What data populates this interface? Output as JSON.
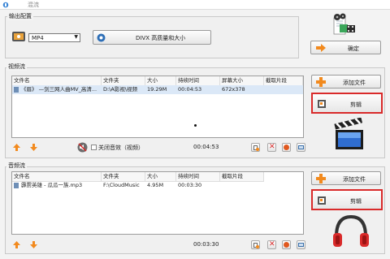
{
  "window": {
    "title": "混流"
  },
  "output": {
    "group_label": "输出配置",
    "format_value": "MP4",
    "quality_value": "DIVX 高质量和大小",
    "confirm_label": "确定"
  },
  "video": {
    "group_label": "视频流",
    "columns": [
      "文件名",
      "文件夹",
      "大小",
      "持续时间",
      "屏幕大小",
      "截取片段"
    ],
    "rows": [
      [
        "《眉》 —剑三网人曲MV_高清...",
        "D:\\A影视\\视频",
        "19.29M",
        "00:04:53",
        "672x378",
        ""
      ]
    ],
    "add_label": "添加文件",
    "edit_label": "剪辑",
    "mute_label": "关闭音效（视频）",
    "total_duration": "00:04:53"
  },
  "audio": {
    "group_label": "音频流",
    "columns": [
      "文件名",
      "文件夹",
      "大小",
      "持续时间",
      "截取片段"
    ],
    "rows": [
      [
        "霹雳英雄 - 瓜瓜一族.mp3",
        "F:\\CloudMusic",
        "4.95M",
        "00:03:30",
        ""
      ]
    ],
    "add_label": "添加文件",
    "edit_label": "剪辑",
    "total_duration": "00:03:30"
  },
  "icons": {
    "app": "app-icon",
    "film_strip": "film-strip-icon",
    "dropdown": "chevron-down-icon",
    "quality": "quality-gear-icon",
    "confirm": "confirm-arrow-icon",
    "add": "plus-icon",
    "edit": "scissors-clip-icon",
    "clapperboard": "clapperboard-icon",
    "headphones": "headphones-icon",
    "up": "move-up-icon",
    "down": "move-down-icon",
    "add_small": "add-small-icon",
    "remove_small": "remove-small-icon",
    "play_small": "play-small-icon",
    "settings_small": "settings-small-icon"
  },
  "colors": {
    "highlight_border": "#d92a2a",
    "accent_orange": "#f28a1e"
  }
}
